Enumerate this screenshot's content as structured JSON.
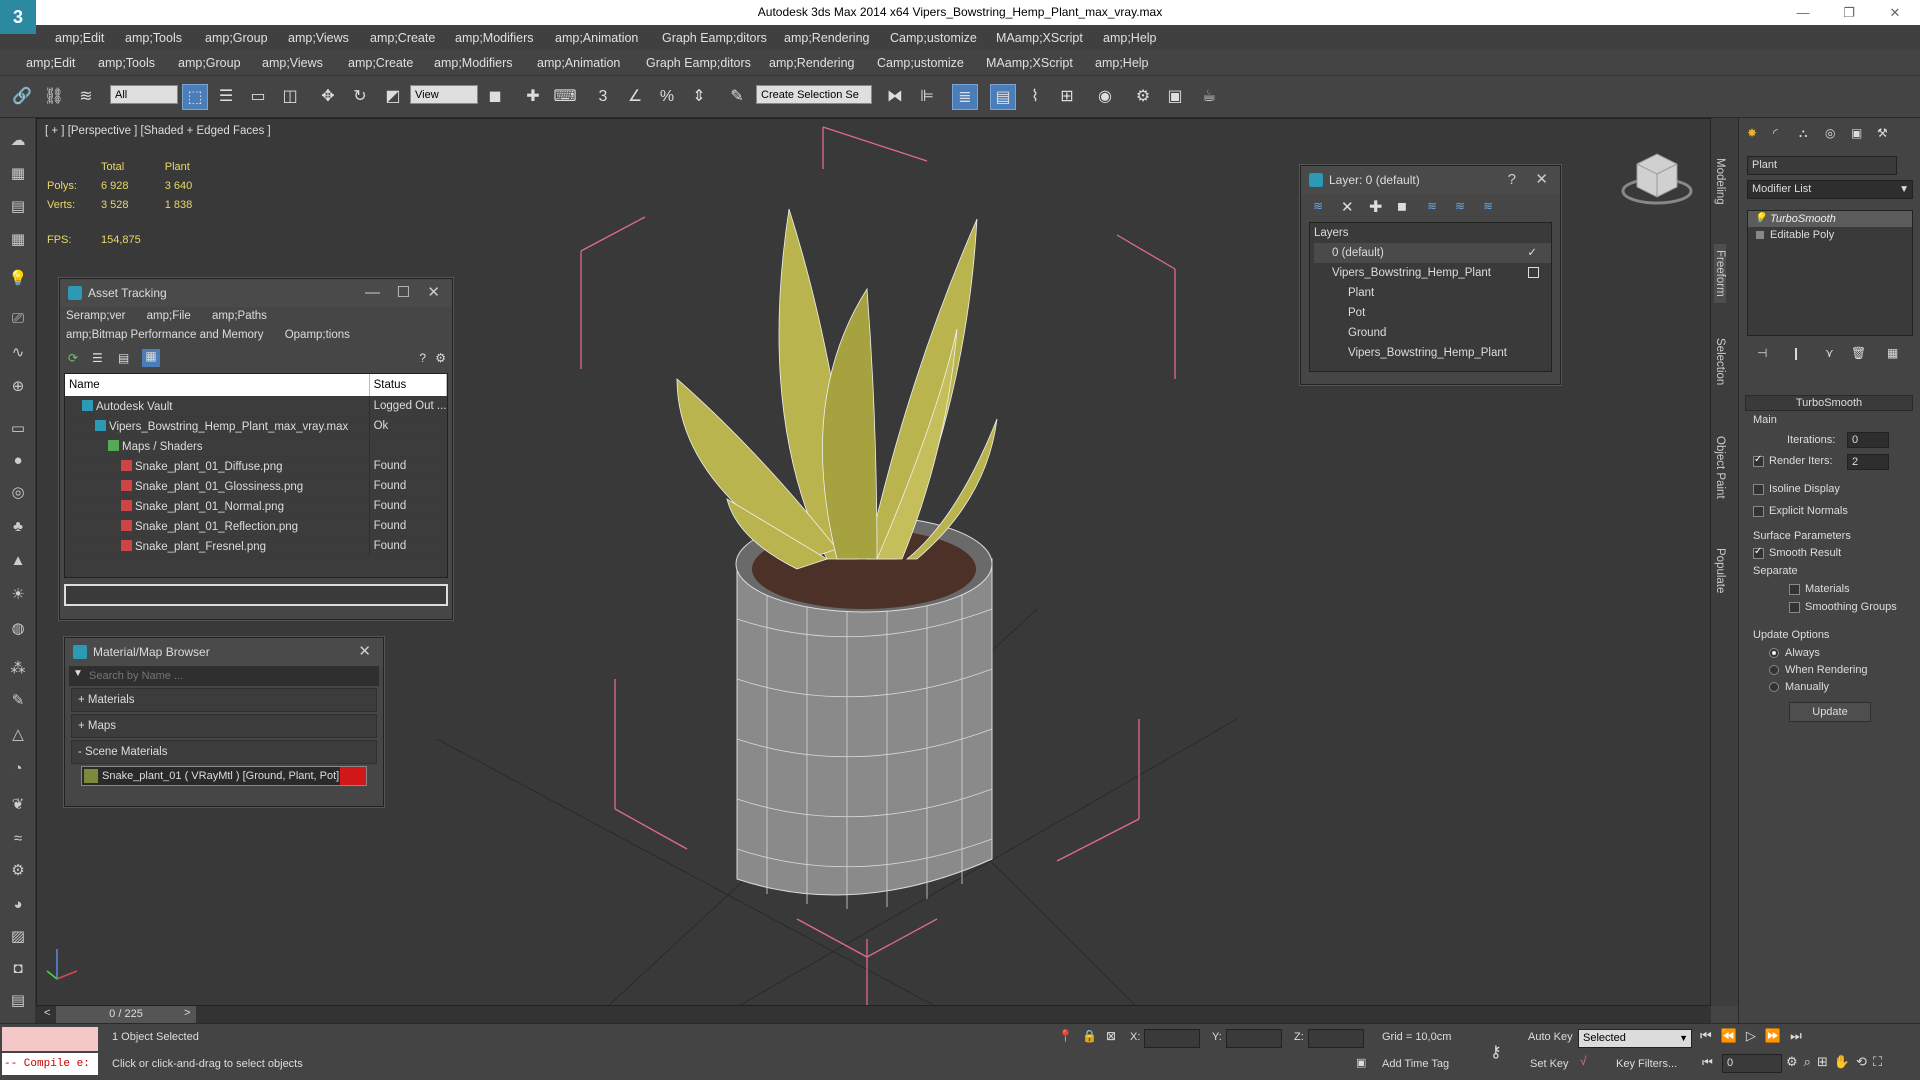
{
  "titlebar": {
    "text": "Autodesk 3ds Max  2014 x64     Vipers_Bowstring_Hemp_Plant_max_vray.max",
    "minimize": "—",
    "restore": "❐",
    "close": "✕"
  },
  "menubar1": [
    "amp;Edit",
    "amp;Tools",
    "amp;Group",
    "amp;Views",
    "amp;Create",
    "amp;Modifiers",
    "amp;Animation",
    "Graph Eamp;ditors",
    "amp;Rendering",
    "Camp;ustomize",
    "MAamp;XScript",
    "amp;Help"
  ],
  "menubar2": [
    "amp;Edit",
    "amp;Tools",
    "amp;Group",
    "amp;Views",
    "amp;Create",
    "amp;Modifiers",
    "amp;Animation",
    "Graph Eamp;ditors",
    "amp;Rendering",
    "Camp;ustomize",
    "MAamp;XScript",
    "amp;Help"
  ],
  "toolbar": {
    "filter": "All",
    "refcoord": "View",
    "selset": "Create Selection Se"
  },
  "viewport": {
    "label": "[ + ] [Perspective ] [Shaded + Edged Faces ]",
    "stats": {
      "col_total": "Total",
      "col_plant": "Plant",
      "polys_label": "Polys:",
      "polys_total": "6 928",
      "polys_plant": "3 640",
      "verts_label": "Verts:",
      "verts_total": "3 528",
      "verts_plant": "1 838",
      "fps_label": "FPS:",
      "fps_value": "154,875"
    }
  },
  "asset_tracking": {
    "title": "Asset Tracking",
    "menu": [
      "Seramp;ver",
      "amp;File",
      "amp;Paths",
      "amp;Bitmap Performance and Memory",
      "Opamp;tions"
    ],
    "columns": [
      "Name",
      "Status"
    ],
    "rows": [
      {
        "name": "Autodesk Vault",
        "status": "Logged Out ...",
        "indent": 1
      },
      {
        "name": "Vipers_Bowstring_Hemp_Plant_max_vray.max",
        "status": "Ok",
        "indent": 2
      },
      {
        "name": "Maps / Shaders",
        "status": "",
        "indent": 3
      },
      {
        "name": "Snake_plant_01_Diffuse.png",
        "status": "Found",
        "indent": 4
      },
      {
        "name": "Snake_plant_01_Glossiness.png",
        "status": "Found",
        "indent": 4
      },
      {
        "name": "Snake_plant_01_Normal.png",
        "status": "Found",
        "indent": 4
      },
      {
        "name": "Snake_plant_01_Reflection.png",
        "status": "Found",
        "indent": 4
      },
      {
        "name": "Snake_plant_Fresnel.png",
        "status": "Found",
        "indent": 4
      }
    ]
  },
  "material_browser": {
    "title": "Material/Map Browser",
    "search_placeholder": "Search by Name ...",
    "materials": "+ Materials",
    "maps": "+ Maps",
    "scene_materials": "- Scene Materials",
    "scene_item": "Snake_plant_01  ( VRayMtl )  [Ground, Plant, Pot]"
  },
  "layer_window": {
    "title": "Layer: 0 (default)",
    "help": "?",
    "header": "Layers",
    "items": [
      "0 (default)",
      "Vipers_Bowstring_Hemp_Plant",
      "Plant",
      "Pot",
      "Ground",
      "Vipers_Bowstring_Hemp_Plant"
    ]
  },
  "side_tabs": [
    "Modeling",
    "Freeform",
    "Selection",
    "Object Paint",
    "Populate"
  ],
  "command_panel": {
    "object_name": "Plant",
    "modifier_list": "Modifier List",
    "stack": [
      "TurboSmooth",
      "Editable Poly"
    ],
    "rollout_title": "TurboSmooth",
    "main": "Main",
    "iterations_label": "Iterations:",
    "iterations_value": "0",
    "render_iters_label": "Render Iters:",
    "render_iters_value": "2",
    "isoline": "Isoline Display",
    "explicit": "Explicit Normals",
    "surface_params": "Surface Parameters",
    "smooth_result": "Smooth Result",
    "separate": "Separate",
    "materials": "Materials",
    "smoothing_groups": "Smoothing Groups",
    "update_options": "Update Options",
    "always": "Always",
    "when_rendering": "When Rendering",
    "manually": "Manually",
    "update_btn": "Update"
  },
  "timeline": {
    "frame": "0 / 225",
    "prev": "<",
    "next": ">"
  },
  "status": {
    "maxscript": "-- Compile e:",
    "selected": "1 Object Selected",
    "prompt": "Click or click-and-drag to select objects",
    "x_label": "X:",
    "y_label": "Y:",
    "z_label": "Z:",
    "grid": "Grid = 10,0cm",
    "auto_key": "Auto Key",
    "set_key": "Set Key",
    "selected_dd": "Selected",
    "key_filters": "Key Filters...",
    "add_time_tag": "Add Time Tag",
    "frame_value": "0"
  }
}
